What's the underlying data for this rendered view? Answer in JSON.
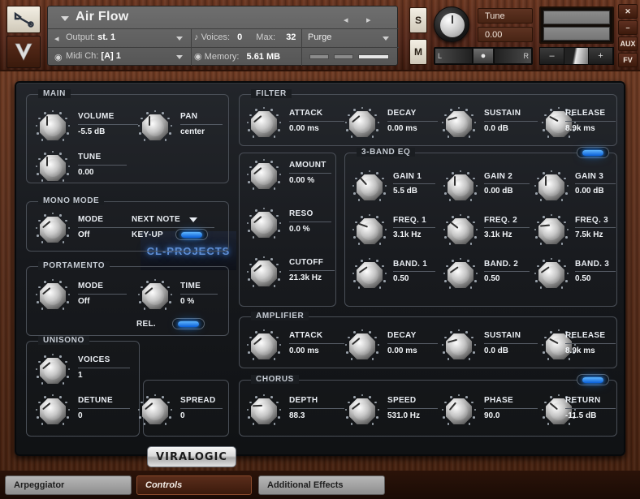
{
  "window": {
    "instrument_title": "Air Flow",
    "edge_buttons": [
      {
        "name": "close",
        "label": "✕"
      },
      {
        "name": "minimize",
        "label": "–"
      },
      {
        "name": "aux",
        "label": "AUX"
      },
      {
        "name": "fv",
        "label": "FV"
      }
    ]
  },
  "header": {
    "wrench_icon": "wrench-icon",
    "v_logo": "V",
    "output": {
      "label": "Output:",
      "value": "st. 1"
    },
    "midi_ch": {
      "label": "Midi Ch:",
      "value": "[A] 1"
    },
    "voices": {
      "label": "Voices:",
      "value": "0"
    },
    "max": {
      "label": "Max:",
      "value": "32"
    },
    "memory": {
      "label": "Memory:",
      "value": "5.61 MB"
    },
    "purge": {
      "label": "Purge"
    },
    "solo_button": "S",
    "mute_button": "M",
    "tune": {
      "label": "Tune",
      "value": "0.00"
    },
    "pan": {
      "left": "L",
      "right": "R"
    },
    "volume": {
      "minus": "–",
      "plus": "+"
    }
  },
  "main": {
    "title": "MAIN",
    "volume": {
      "label": "VOLUME",
      "value": "-5.5 dB"
    },
    "pan": {
      "label": "PAN",
      "value": "center"
    },
    "tune": {
      "label": "TUNE",
      "value": "0.00"
    },
    "brand_display": "CL-PROJECTS"
  },
  "mono_mode": {
    "title": "MONO MODE",
    "mode": {
      "label": "MODE",
      "value": "Off"
    },
    "next_note": "NEXT NOTE",
    "key_up": {
      "label": "KEY-UP",
      "state": "on"
    }
  },
  "portamento": {
    "title": "PORTAMENTO",
    "mode": {
      "label": "MODE",
      "value": "Off"
    },
    "time": {
      "label": "TIME",
      "value": "0 %"
    },
    "rel": {
      "label": "REL.",
      "state": "on"
    }
  },
  "unisono": {
    "title": "UNISONO",
    "voices": {
      "label": "VOICES",
      "value": "1"
    },
    "detune": {
      "label": "DETUNE",
      "value": "0"
    },
    "spread": {
      "label": "SPREAD",
      "value": "0"
    },
    "logo": "VIRALOGIC"
  },
  "filter": {
    "title": "FILTER",
    "envelope": [
      {
        "label": "ATTACK",
        "value": "0.00 ms"
      },
      {
        "label": "DECAY",
        "value": "0.00 ms"
      },
      {
        "label": "SUSTAIN",
        "value": "0.0 dB"
      },
      {
        "label": "RELEASE",
        "value": "8.9k ms"
      }
    ],
    "amount": {
      "label": "AMOUNT",
      "value": "0.00 %"
    },
    "reso": {
      "label": "RESO",
      "value": "0.0 %"
    },
    "cutoff": {
      "label": "CUTOFF",
      "value": "21.3k Hz"
    }
  },
  "eq": {
    "title": "3-BAND EQ",
    "enabled": "on",
    "gain": [
      {
        "label": "GAIN 1",
        "value": "5.5 dB"
      },
      {
        "label": "GAIN 2",
        "value": "0.00 dB"
      },
      {
        "label": "GAIN 3",
        "value": "0.00 dB"
      }
    ],
    "freq": [
      {
        "label": "FREQ. 1",
        "value": "3.1k Hz"
      },
      {
        "label": "FREQ. 2",
        "value": "3.1k Hz"
      },
      {
        "label": "FREQ. 3",
        "value": "7.5k Hz"
      }
    ],
    "band": [
      {
        "label": "BAND. 1",
        "value": "0.50"
      },
      {
        "label": "BAND. 2",
        "value": "0.50"
      },
      {
        "label": "BAND. 3",
        "value": "0.50"
      }
    ]
  },
  "amplifier": {
    "title": "AMPLIFIER",
    "envelope": [
      {
        "label": "ATTACK",
        "value": "0.00 ms"
      },
      {
        "label": "DECAY",
        "value": "0.00 ms"
      },
      {
        "label": "SUSTAIN",
        "value": "0.0 dB"
      },
      {
        "label": "RELEASE",
        "value": "8.9k ms"
      }
    ]
  },
  "chorus": {
    "title": "CHORUS",
    "enabled": "on",
    "params": [
      {
        "label": "DEPTH",
        "value": "88.3"
      },
      {
        "label": "SPEED",
        "value": "531.0 Hz"
      },
      {
        "label": "PHASE",
        "value": "90.0"
      },
      {
        "label": "RETURN",
        "value": "-11.5 dB"
      }
    ]
  },
  "tabs": [
    {
      "label": "Arpeggiator",
      "active": false
    },
    {
      "label": "Controls",
      "active": true
    },
    {
      "label": "Additional Effects",
      "active": false
    }
  ]
}
